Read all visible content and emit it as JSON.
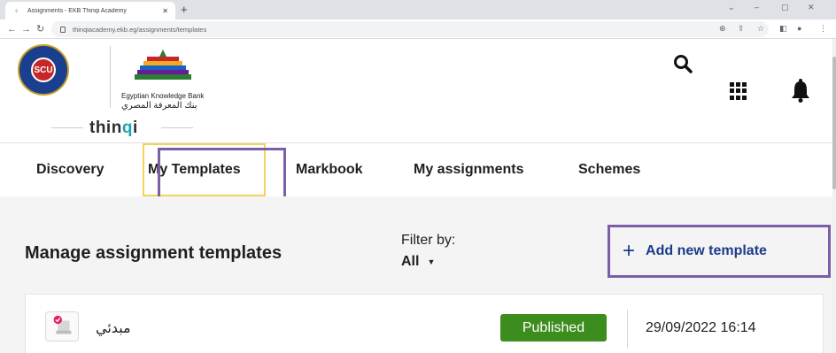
{
  "browser": {
    "tab_title": "Assignments - EKB Thinqi Academy",
    "tab_close": "✕",
    "new_tab": "+",
    "url": "thinqiacademy.ekb.eg/assignments/templates",
    "window_controls": [
      "⌄",
      "–",
      "▢",
      "✕"
    ]
  },
  "header": {
    "scu_text": "SCU",
    "ekb_english": "Egyptian Knowledge Bank",
    "ekb_arabic": "بنك المعرفة المصري",
    "thinqi_prefix": "thin",
    "thinqi_q": "q",
    "thinqi_suffix": "i"
  },
  "nav": {
    "items": [
      "Discovery",
      "My Templates",
      "Markbook",
      "My assignments",
      "Schemes"
    ]
  },
  "page": {
    "title": "Manage assignment templates",
    "filter_label": "Filter by:",
    "filter_value": "All",
    "add_button_label": "Add new template",
    "add_button_icon": "+"
  },
  "templates": [
    {
      "name": "مبدئي",
      "status": "Published",
      "date": "29/09/2022 16:14"
    }
  ],
  "colors": {
    "accent_blue": "#1c3b8a",
    "published_green": "#3d8c1e",
    "highlight_purple": "#7b5ea7",
    "highlight_yellow": "#f5d45a",
    "thinqi_teal": "#1aa6b7"
  }
}
